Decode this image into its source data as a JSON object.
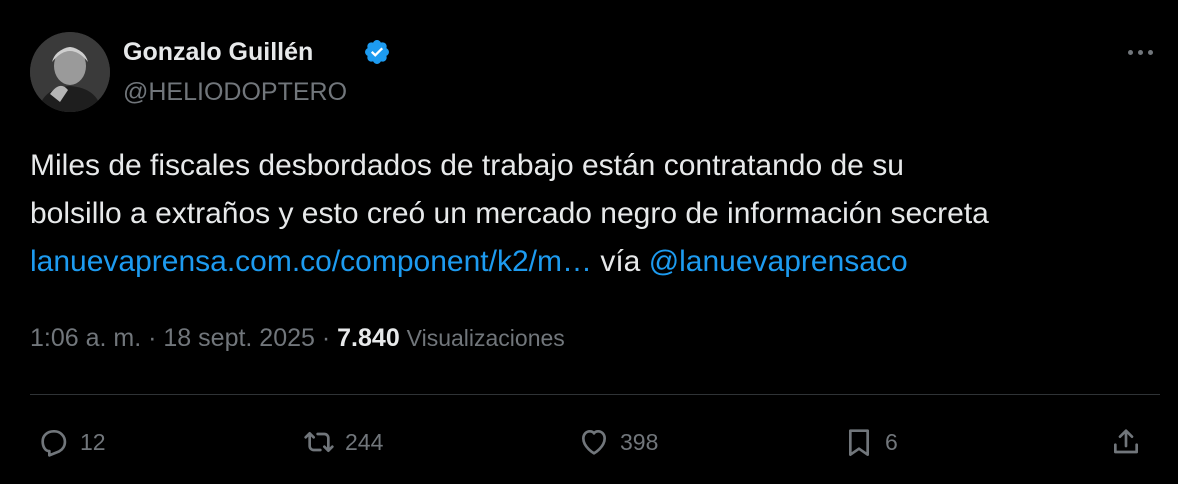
{
  "author": {
    "display_name": "Gonzalo Guillén",
    "handle": "@HELIODOPTERO",
    "verified": true,
    "verified_color": "#1d9bf0"
  },
  "menu": {
    "icon": "more-horizontal-icon"
  },
  "tweet": {
    "line1": "Miles de fiscales desbordados de trabajo están contratando de su",
    "line2": "bolsillo a extraños y esto creó un mercado negro de información secreta",
    "link_text": "lanuevaprensa.com.co/component/k2/m…",
    "via_text": "vía",
    "mention": "@lanuevaprensaco"
  },
  "meta": {
    "time": "1:06 a. m.",
    "separator": "·",
    "date": "18 sept. 2025",
    "views_count": "7.840",
    "views_label": "Visualizaciones"
  },
  "actions": {
    "reply": {
      "icon": "reply-icon",
      "count": "12"
    },
    "repost": {
      "icon": "repost-icon",
      "count": "244"
    },
    "like": {
      "icon": "heart-icon",
      "count": "398"
    },
    "bookmark": {
      "icon": "bookmark-icon",
      "count": "6"
    },
    "share": {
      "icon": "share-icon"
    }
  },
  "colors": {
    "background": "#000000",
    "text": "#e7e9ea",
    "secondary": "#71767b",
    "link": "#1d9bf0",
    "divider": "#2f3336"
  }
}
